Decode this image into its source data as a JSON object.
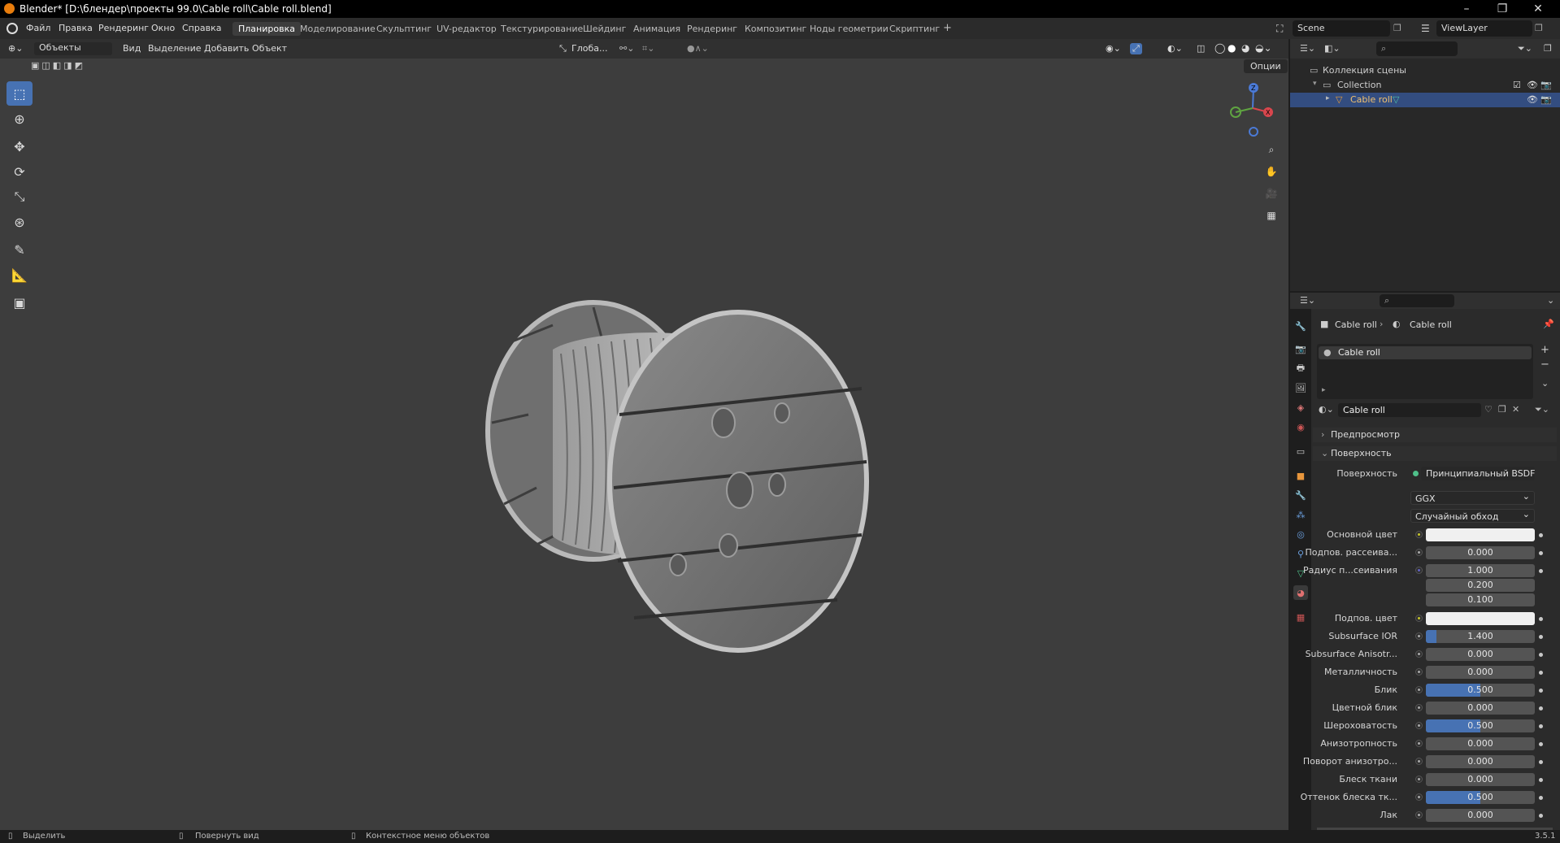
{
  "window": {
    "title": "Blender* [D:\\блендер\\проекты 99.0\\Cable roll\\Cable roll.blend]",
    "controls": [
      "–",
      "❐",
      "✕"
    ]
  },
  "menubar": {
    "items": [
      "Файл",
      "Правка",
      "Рендеринг",
      "Окно",
      "Справка"
    ]
  },
  "workspaces": {
    "tabs": [
      "Планировка",
      "Моделирование",
      "Скульптинг",
      "UV-редактор",
      "Текстурирование",
      "Шейдинг",
      "Анимация",
      "Рендеринг",
      "Композитинг",
      "Ноды геометрии",
      "Скриптинг"
    ],
    "active": "Планировка",
    "add": "+"
  },
  "scene": {
    "name": "Scene",
    "view_layer": "ViewLayer"
  },
  "viewport_header": {
    "mode": "Объекты",
    "menus": [
      "Вид",
      "Выделение",
      "Добавить",
      "Объект"
    ],
    "orientation": "Глоба...",
    "options": "Опции"
  },
  "tools": [
    "select-box",
    "cursor",
    "move",
    "rotate",
    "scale",
    "transform",
    "annotate",
    "measure",
    "add-cube"
  ],
  "gizmo": {
    "z": "Z",
    "x": "X",
    "y": "Y"
  },
  "outliner": {
    "root": "Коллекция сцены",
    "collection": "Collection",
    "object": "Cable roll"
  },
  "properties": {
    "breadcrumb_object": "Cable roll",
    "breadcrumb_material": "Cable roll",
    "slot_name": "Cable roll",
    "material_name": "Cable roll",
    "sections": {
      "preview": "Предпросмотр",
      "surface": "Поверхность"
    },
    "surface_label": "Поверхность",
    "surface_value": "Принципиальный BSDF",
    "distribution": "GGX",
    "subsurface_method": "Случайный обход",
    "rows": [
      {
        "label": "Основной цвет",
        "value": "",
        "kind": "color",
        "socket": "yellow"
      },
      {
        "label": "Подпов. рассеива...",
        "value": "0.000",
        "kind": "num",
        "fill": 0,
        "socket": "grey"
      },
      {
        "label": "Радиус п...сеивания",
        "value": "1.000",
        "kind": "vec",
        "fill": 0,
        "socket": "purple"
      },
      {
        "label": "",
        "value": "0.200",
        "kind": "vec",
        "fill": 0,
        "socket": ""
      },
      {
        "label": "",
        "value": "0.100",
        "kind": "vec",
        "fill": 0,
        "socket": ""
      },
      {
        "label": "Подпов. цвет",
        "value": "",
        "kind": "color",
        "socket": "yellow"
      },
      {
        "label": "Subsurface IOR",
        "value": "1.400",
        "kind": "num",
        "fill": 0.1,
        "socket": "grey"
      },
      {
        "label": "Subsurface Anisotr...",
        "value": "0.000",
        "kind": "num",
        "fill": 0,
        "socket": "grey"
      },
      {
        "label": "Металличность",
        "value": "0.000",
        "kind": "num",
        "fill": 0,
        "socket": "grey"
      },
      {
        "label": "Блик",
        "value": "0.500",
        "kind": "num",
        "fill": 0.5,
        "socket": "grey"
      },
      {
        "label": "Цветной блик",
        "value": "0.000",
        "kind": "num",
        "fill": 0,
        "socket": "grey"
      },
      {
        "label": "Шероховатость",
        "value": "0.500",
        "kind": "num",
        "fill": 0.5,
        "socket": "grey"
      },
      {
        "label": "Анизотропность",
        "value": "0.000",
        "kind": "num",
        "fill": 0,
        "socket": "grey"
      },
      {
        "label": "Поворот анизотро...",
        "value": "0.000",
        "kind": "num",
        "fill": 0,
        "socket": "grey"
      },
      {
        "label": "Блеск ткани",
        "value": "0.000",
        "kind": "num",
        "fill": 0,
        "socket": "grey"
      },
      {
        "label": "Оттенок блеска тк...",
        "value": "0.500",
        "kind": "num",
        "fill": 0.5,
        "socket": "grey"
      },
      {
        "label": "Лак",
        "value": "0.000",
        "kind": "num",
        "fill": 0,
        "socket": "grey"
      }
    ]
  },
  "statusbar": {
    "select": "Выделить",
    "rotate": "Повернуть вид",
    "context": "Контекстное меню объектов",
    "version": "3.5.1"
  }
}
